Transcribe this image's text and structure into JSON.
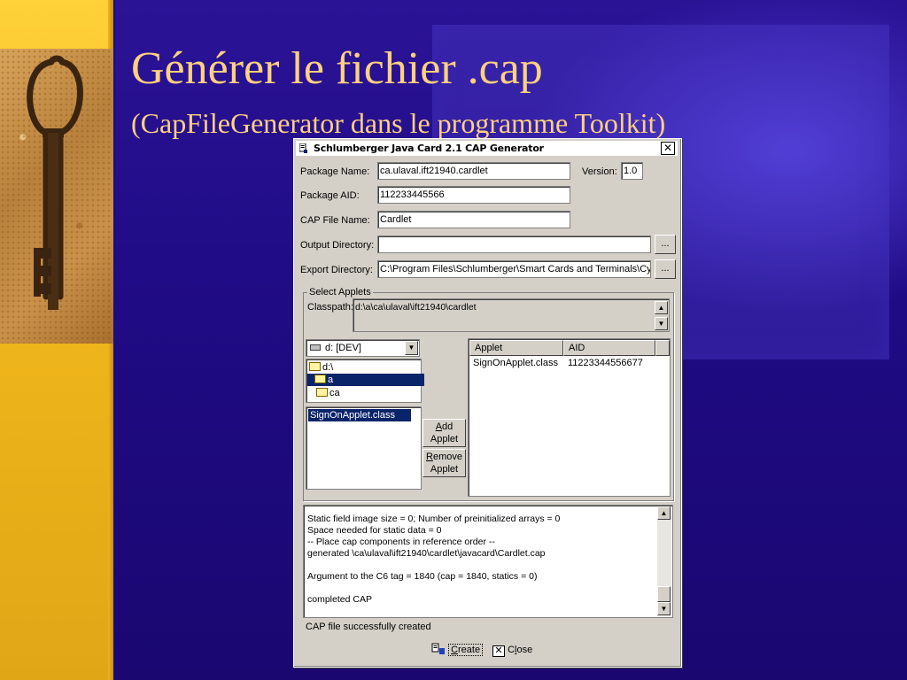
{
  "slide": {
    "title": "Générer le fichier .cap",
    "subtitle": "(CapFileGenerator dans le programme Toolkit)"
  },
  "window": {
    "title": "Schlumberger Java Card 2.1 CAP Generator",
    "close_glyph": "✕",
    "package_name_label": "Package Name:",
    "package_name_value": "ca.ulaval.ift21940.cardlet",
    "version_label": "Version:",
    "version_value": "1.0",
    "package_aid_label": "Package AID:",
    "package_aid_value": "112233445566",
    "cap_file_name_label": "CAP File Name:",
    "cap_file_name_value": "Cardlet",
    "output_dir_label": "Output Directory:",
    "output_dir_value": "",
    "export_dir_label": "Export Directory:",
    "export_dir_value": "C:\\Program Files\\Schlumberger\\Smart Cards and Terminals\\Cybe",
    "browse_label": "...",
    "select_applets_title": "Select Applets",
    "classpath_label": "Classpath:",
    "classpath_value": "d:\\a\\ca\\ulaval\\ift21940\\cardlet",
    "drive": "d: [DEV]",
    "directories": [
      "d:\\",
      "a",
      "ca"
    ],
    "files": [
      "SignOnApplet.class"
    ],
    "add_applet_line1": "dd",
    "add_applet_line1_mnemonic": "A",
    "add_applet_line2": "Applet",
    "remove_applet_line1": "emove",
    "remove_applet_line1_mnemonic": "R",
    "remove_applet_line2": "Applet",
    "table_headers": [
      "Applet",
      "AID"
    ],
    "table_rows": [
      {
        "applet": "SignOnApplet.class",
        "aid": "11223344556677"
      }
    ],
    "log_lines": [
      "Static field image size = 0; Number of preinitialized arrays = 0",
      "Space needed for static data = 0",
      "-- Place cap components in reference order --",
      "generated \\ca\\ulaval\\ift21940\\cardlet\\javacard\\Cardlet.cap",
      "",
      "Argument to the C6 tag = 1840 (cap = 1840, statics = 0)",
      "",
      "completed CAP"
    ],
    "status": "CAP file successfully created",
    "create_mnemonic": "C",
    "create_rest": "reate",
    "close_prefix": "C",
    "close_mnemonic": "l",
    "close_rest": "ose"
  }
}
